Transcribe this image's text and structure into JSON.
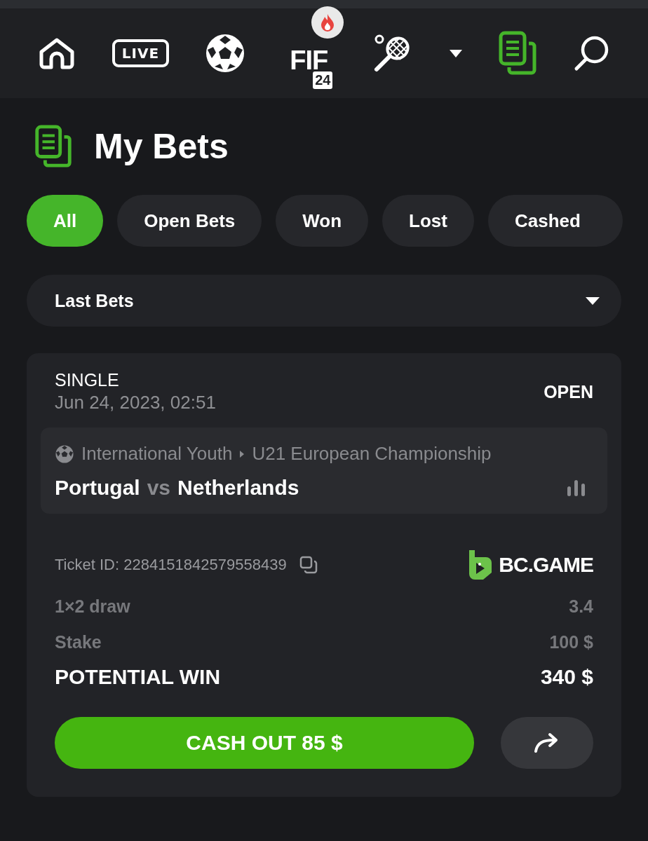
{
  "nav": [
    {
      "kind": "home",
      "selected": false
    },
    {
      "kind": "live",
      "label": "LIVE",
      "selected": false
    },
    {
      "kind": "soccer",
      "selected": false
    },
    {
      "kind": "fifa",
      "label": "FIF",
      "sub": "24",
      "hot": true,
      "selected": false
    },
    {
      "kind": "tennis",
      "selected": false
    },
    {
      "kind": "caret",
      "selected": false
    },
    {
      "kind": "bets",
      "selected": true
    },
    {
      "kind": "search",
      "selected": false
    }
  ],
  "page_title": "My Bets",
  "filters": [
    {
      "label": "All",
      "selected": true
    },
    {
      "label": "Open Bets",
      "selected": false
    },
    {
      "label": "Won",
      "selected": false
    },
    {
      "label": "Lost",
      "selected": false
    },
    {
      "label": "Cashed",
      "selected": false
    }
  ],
  "period_select": {
    "value": "Last Bets"
  },
  "bet": {
    "type": "SINGLE",
    "date": "Jun 24, 2023, 02:51",
    "status": "OPEN",
    "league": [
      "International Youth",
      "U21 European Championship"
    ],
    "home": "Portugal",
    "vs": "vs",
    "away": "Netherlands",
    "ticket": "Ticket ID: 2284151842579558439",
    "brand": "BC.GAME",
    "lines": [
      {
        "label": "1×2 draw",
        "value": "3.4",
        "kind": "minor"
      },
      {
        "label": "Stake",
        "value": "100 $",
        "kind": "minor"
      },
      {
        "label": "POTENTIAL WIN",
        "value": "340 $",
        "kind": "major"
      }
    ],
    "cashout": "CASH OUT 85 $"
  }
}
